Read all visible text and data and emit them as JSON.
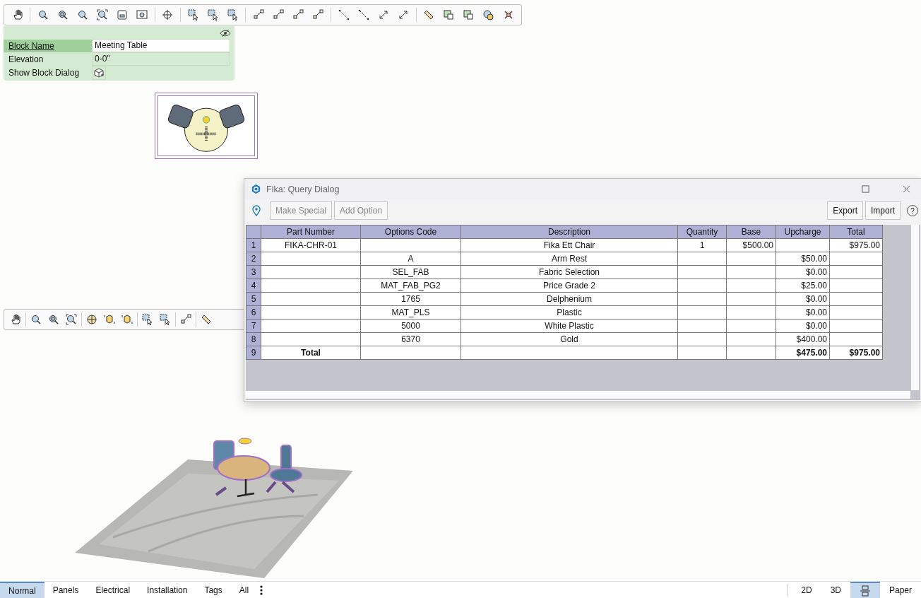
{
  "properties": {
    "rows": [
      {
        "label": "Block Name",
        "value": "Meeting Table",
        "kind": "text",
        "selected": true
      },
      {
        "label": "Elevation",
        "value": "0-0\"",
        "kind": "text",
        "selected": false
      },
      {
        "label": "Show Block Dialog",
        "kind": "button",
        "selected": false
      }
    ]
  },
  "dialog": {
    "title": "Fika: Query Dialog",
    "toolbar_buttons": [
      {
        "label": "Make Special",
        "disabled": true
      },
      {
        "label": "Add Option",
        "disabled": true
      }
    ],
    "right_buttons": [
      {
        "label": "Export",
        "disabled": false
      },
      {
        "label": "Import",
        "disabled": false
      }
    ],
    "help": "?",
    "table": {
      "columns": [
        "Part Number",
        "Options Code",
        "Description",
        "Quantity",
        "Base",
        "Upcharge",
        "Total"
      ],
      "rows": [
        {
          "number": "1",
          "kind": "item",
          "cells": [
            "FIKA-CHR-01",
            "",
            "Fika Ett Chair",
            "1",
            "$500.00",
            "",
            "$975.00"
          ]
        },
        {
          "number": "2",
          "kind": "item",
          "cells": [
            "",
            "A",
            "Arm Rest",
            "",
            "",
            "$50.00",
            ""
          ]
        },
        {
          "number": "3",
          "kind": "item",
          "cells": [
            "",
            "SEL_FAB",
            "Fabric Selection",
            "",
            "",
            "$0.00",
            ""
          ]
        },
        {
          "number": "4",
          "kind": "item",
          "cells": [
            "",
            "MAT_FAB_PG2",
            "Price Grade 2",
            "",
            "",
            "$25.00",
            ""
          ]
        },
        {
          "number": "5",
          "kind": "item",
          "cells": [
            "",
            "1765",
            "Delphenium",
            "",
            "",
            "$0.00",
            ""
          ]
        },
        {
          "number": "6",
          "kind": "item",
          "cells": [
            "",
            "MAT_PLS",
            "Plastic",
            "",
            "",
            "$0.00",
            ""
          ]
        },
        {
          "number": "7",
          "kind": "item",
          "cells": [
            "",
            "5000",
            "White Plastic",
            "",
            "",
            "$0.00",
            ""
          ]
        },
        {
          "number": "8",
          "kind": "item",
          "cells": [
            "",
            "6370",
            "Gold",
            "",
            "",
            "$400.00",
            ""
          ]
        },
        {
          "number": "9",
          "kind": "total",
          "cells": [
            "Total",
            "",
            "",
            "",
            "",
            "$475.00",
            "$975.00"
          ]
        }
      ]
    }
  },
  "status_bar": {
    "tabs": [
      {
        "label": "Normal",
        "selected": true
      },
      {
        "label": "Panels",
        "selected": false
      },
      {
        "label": "Electrical",
        "selected": false
      },
      {
        "label": "Installation",
        "selected": false
      },
      {
        "label": "Tags",
        "selected": false
      },
      {
        "label": "All",
        "selected": false
      }
    ],
    "views": [
      {
        "kind": "text",
        "label": "2D",
        "selected": false
      },
      {
        "kind": "text",
        "label": "3D",
        "selected": false
      },
      {
        "kind": "icon",
        "selected": true
      },
      {
        "kind": "text",
        "label": "Paper",
        "selected": false
      }
    ]
  }
}
